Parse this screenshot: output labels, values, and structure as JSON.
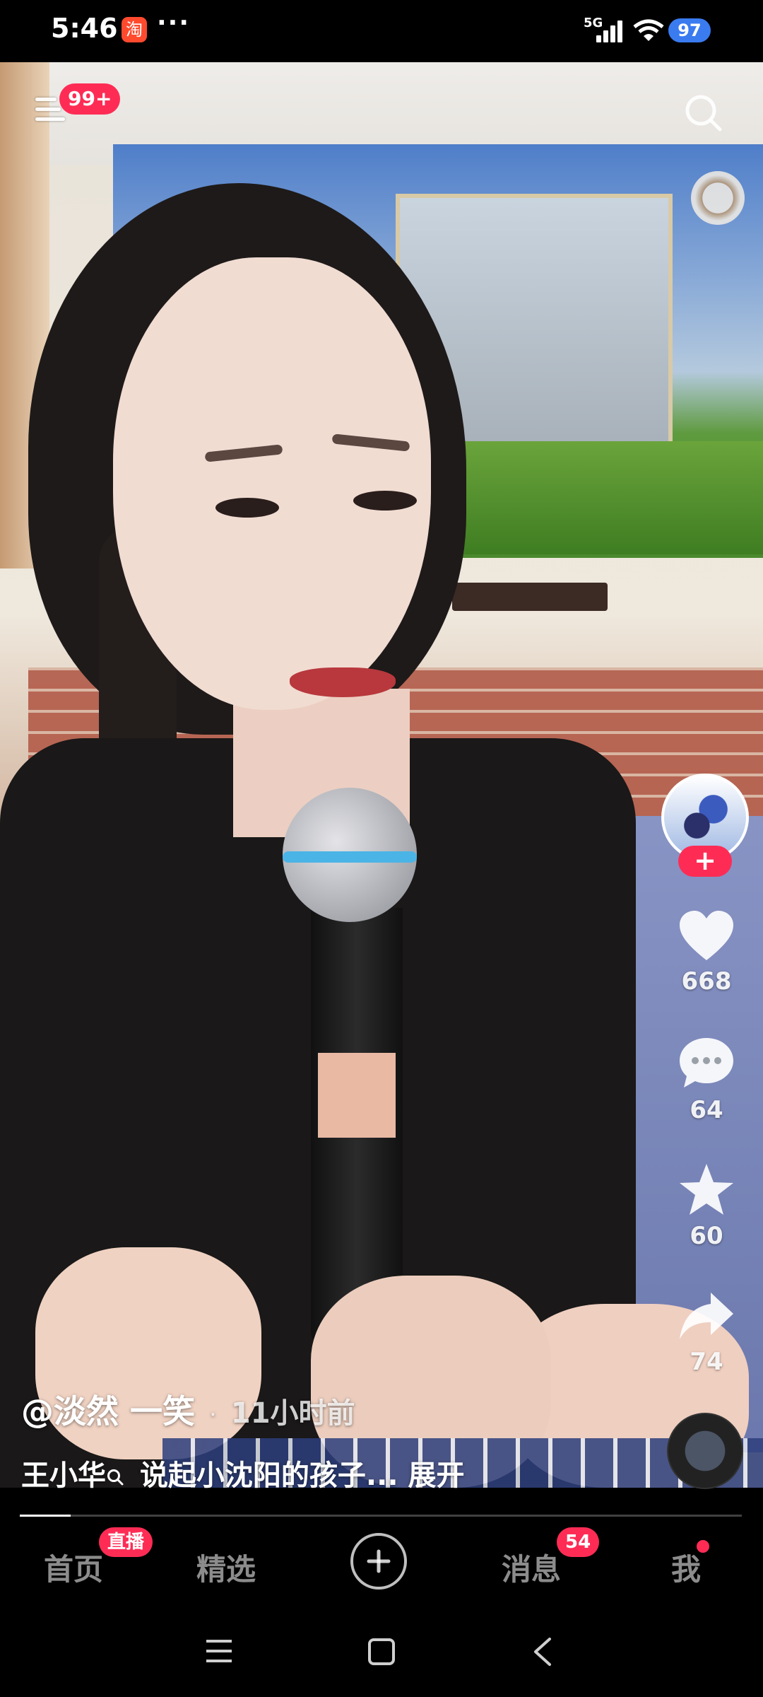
{
  "status_bar": {
    "time": "5:46",
    "network": "5G",
    "battery": "97",
    "notification_dots": "···",
    "taobao_icon_char": "淘"
  },
  "top": {
    "notification_badge": "99+"
  },
  "actions": {
    "follow_symbol": "+",
    "like_count": "668",
    "comment_count": "64",
    "favorite_count": "60",
    "share_count": "74"
  },
  "caption": {
    "author": "@淡然  一笑",
    "separator": "·",
    "time_ago": "11小时前",
    "tag": "王小华",
    "description": "说起小沈阳的孩子...",
    "expand": "展开"
  },
  "progress": {
    "fraction": 0.07
  },
  "nav": {
    "home": "首页",
    "live_badge": "直播",
    "featured": "精选",
    "messages": "消息",
    "messages_badge": "54",
    "me": "我"
  },
  "colors": {
    "accent": "#fe2c55",
    "battery": "#3a7bf0"
  }
}
